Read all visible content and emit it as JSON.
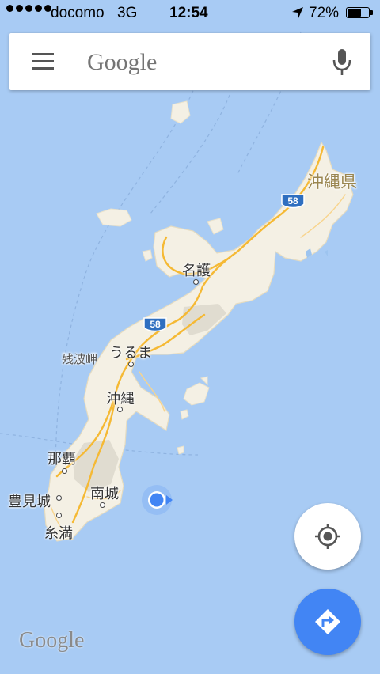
{
  "status_bar": {
    "carrier": "docomo",
    "network": "3G",
    "time": "12:54",
    "battery": "72%",
    "battery_level": 0.72,
    "signal_bars": 5,
    "location_icon": "location-arrow-icon"
  },
  "search": {
    "placeholder": "Google",
    "menu_icon": "hamburger-menu-icon",
    "mic_icon": "microphone-icon"
  },
  "map": {
    "prefecture_label": "沖縄県",
    "places": [
      {
        "id": "nago",
        "label": "名護"
      },
      {
        "id": "uruma",
        "label": "うるま"
      },
      {
        "id": "zanpa",
        "label": "残波岬"
      },
      {
        "id": "okinawa",
        "label": "沖縄"
      },
      {
        "id": "naha",
        "label": "那覇"
      },
      {
        "id": "nanjo",
        "label": "南城"
      },
      {
        "id": "tomigusuku",
        "label": "豊見城"
      },
      {
        "id": "itoman",
        "label": "糸満"
      }
    ],
    "routes": [
      {
        "id": "route-58-north",
        "label": "58"
      },
      {
        "id": "route-58-central",
        "label": "58"
      }
    ],
    "colors": {
      "water": "#a8cbf4",
      "land": "#f4f0e4",
      "road": "#f5b934",
      "accent": "#4285f4"
    }
  },
  "controls": {
    "my_location_icon": "my-location-icon",
    "directions_icon": "directions-icon"
  },
  "watermark": "Google"
}
